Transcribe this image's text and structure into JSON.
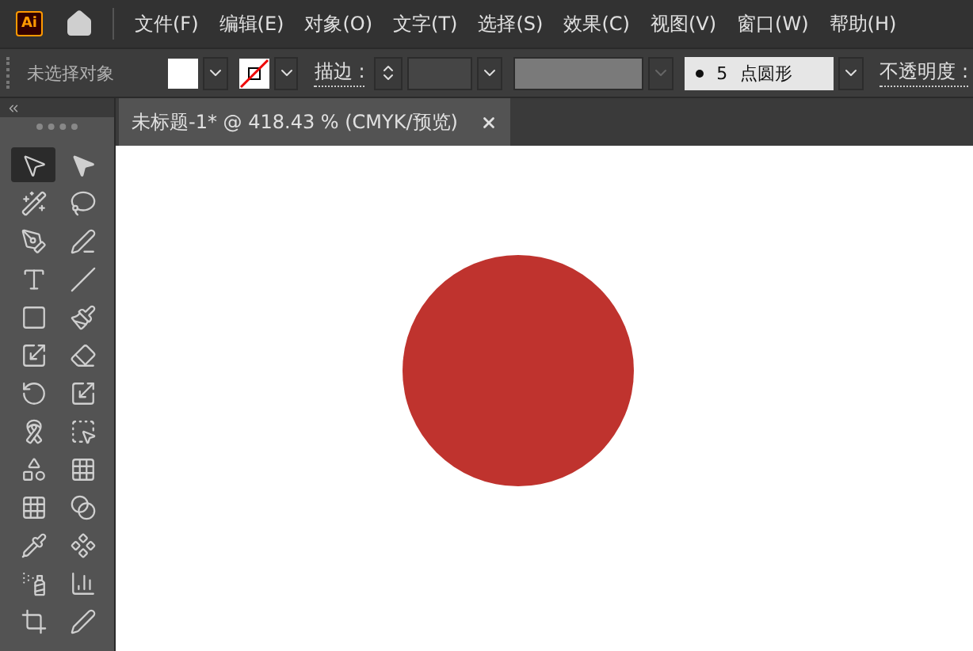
{
  "app": {
    "logo": "Ai"
  },
  "menu": [
    "文件(F)",
    "编辑(E)",
    "对象(O)",
    "文字(T)",
    "选择(S)",
    "效果(C)",
    "视图(V)",
    "窗口(W)",
    "帮助(H)"
  ],
  "control_bar": {
    "selection_status": "未选择对象",
    "stroke_label": "描边 :",
    "brush": {
      "size": "5",
      "name": "点圆形"
    },
    "opacity_label": "不透明度 :"
  },
  "document_tab": {
    "title": "未标题-1*  @ 418.43 % (CMYK/预览)",
    "selected": true
  },
  "tools": [
    {
      "selected": true
    },
    {
      "selected": false
    },
    {
      "selected": false
    },
    {
      "selected": false
    },
    {
      "selected": false
    },
    {
      "selected": false
    },
    {
      "selected": false
    },
    {
      "selected": false
    },
    {
      "selected": false
    },
    {
      "selected": false
    },
    {
      "selected": false
    },
    {
      "selected": false
    },
    {
      "selected": false
    },
    {
      "selected": false
    },
    {
      "selected": false
    },
    {
      "selected": false
    },
    {
      "selected": false
    },
    {
      "selected": false
    },
    {
      "selected": false
    },
    {
      "selected": false
    },
    {
      "selected": false
    },
    {
      "selected": false
    },
    {
      "selected": false
    },
    {
      "selected": false
    },
    {
      "selected": false
    },
    {
      "selected": false
    }
  ]
}
